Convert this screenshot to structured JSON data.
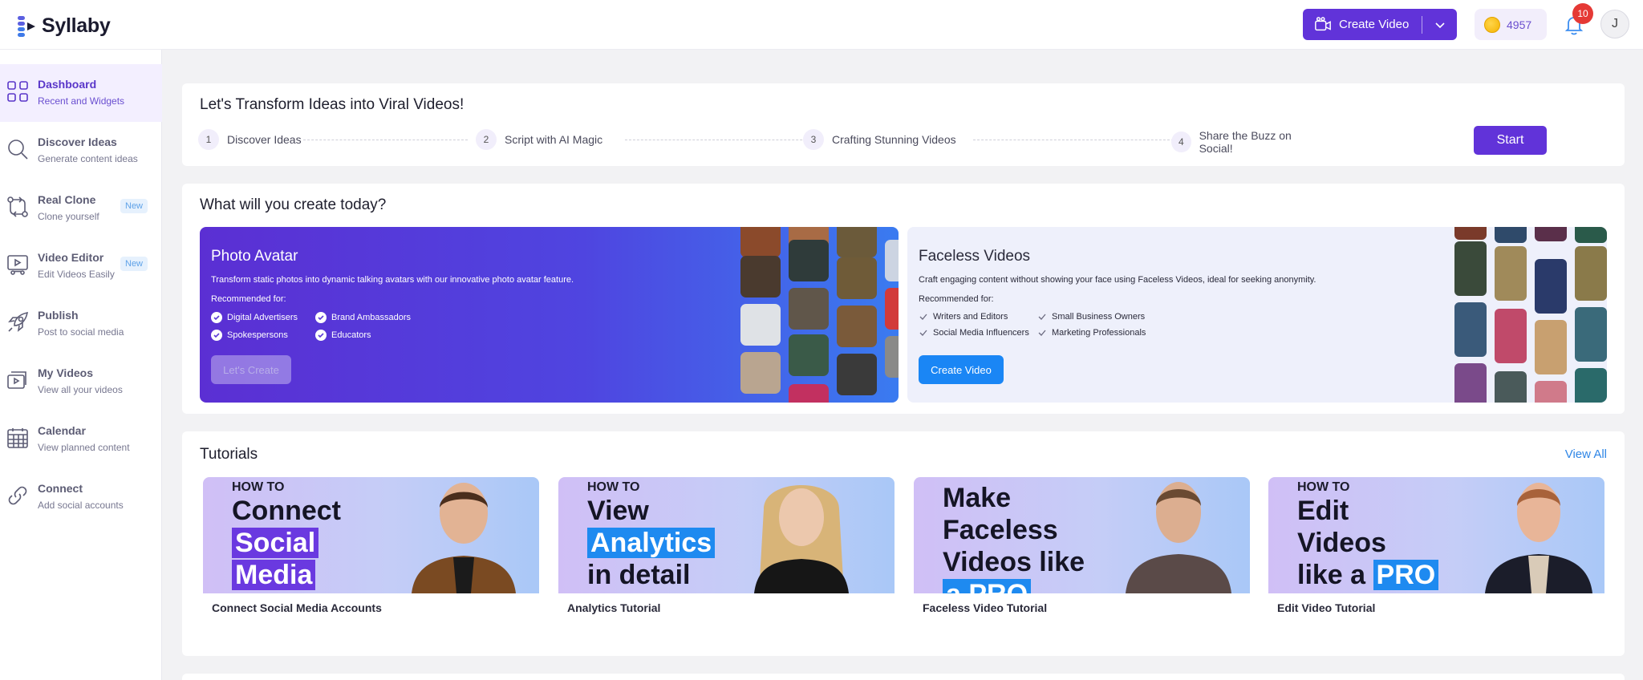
{
  "brand": {
    "name": "Syllaby",
    "accent": "#6133d9"
  },
  "header": {
    "create_video_label": "Create Video",
    "credits": "4957",
    "notifications_count": "10",
    "avatar_initial": "J"
  },
  "sidebar": {
    "items": [
      {
        "title": "Dashboard",
        "subtitle": "Recent and Widgets",
        "icon": "dashboard-icon",
        "active": true
      },
      {
        "title": "Discover Ideas",
        "subtitle": "Generate content ideas",
        "icon": "search-icon"
      },
      {
        "title": "Real Clone",
        "subtitle": "Clone yourself",
        "icon": "clone-icon",
        "badge": "New"
      },
      {
        "title": "Video Editor",
        "subtitle": "Edit Videos Easily",
        "icon": "video-editor-icon",
        "badge": "New"
      },
      {
        "title": "Publish",
        "subtitle": "Post to social media",
        "icon": "rocket-icon"
      },
      {
        "title": "My Videos",
        "subtitle": "View all your videos",
        "icon": "videos-icon"
      },
      {
        "title": "Calendar",
        "subtitle": "View planned content",
        "icon": "calendar-icon"
      },
      {
        "title": "Connect",
        "subtitle": "Add social accounts",
        "icon": "link-icon"
      }
    ]
  },
  "intro": {
    "title": "Let's Transform Ideas into Viral Videos!",
    "steps": [
      {
        "num": "1",
        "label": "Discover Ideas"
      },
      {
        "num": "2",
        "label": "Script with AI Magic"
      },
      {
        "num": "3",
        "label": "Crafting Stunning Videos"
      },
      {
        "num": "4",
        "label": "Share the Buzz on Social!"
      }
    ],
    "start_label": "Start"
  },
  "create": {
    "title": "What will you create today?",
    "photo_avatar": {
      "title": "Photo Avatar",
      "description": "Transform static photos into dynamic talking avatars with our innovative photo avatar feature.",
      "recommended_label": "Recommended for:",
      "items": [
        "Digital Advertisers",
        "Brand Ambassadors",
        "Spokespersons",
        "Educators"
      ],
      "button": "Let's Create"
    },
    "faceless": {
      "title": "Faceless Videos",
      "description": "Craft engaging content without showing your face using Faceless Videos, ideal for seeking anonymity.",
      "recommended_label": "Recommended for:",
      "items": [
        "Writers and Editors",
        "Small Business Owners",
        "Social Media Influencers",
        "Marketing Professionals"
      ],
      "button": "Create Video"
    }
  },
  "tutorials": {
    "title": "Tutorials",
    "view_all": "View All",
    "items": [
      {
        "title": "Connect Social Media Accounts",
        "howto": "HOW TO",
        "line1": "Connect",
        "line2": "Social",
        "line3": "Media"
      },
      {
        "title": "Analytics Tutorial",
        "howto": "HOW TO",
        "line1": "View",
        "line2": "Analytics",
        "line3": "in detail"
      },
      {
        "title": "Faceless Video Tutorial",
        "line1": "Make",
        "line2": "Faceless",
        "line3": "Videos like",
        "line4": "a PRO"
      },
      {
        "title": "Edit Video Tutorial",
        "howto": "HOW TO",
        "line1": "Edit",
        "line2": "Videos",
        "line3": "like a",
        "line4": "PRO"
      }
    ]
  }
}
